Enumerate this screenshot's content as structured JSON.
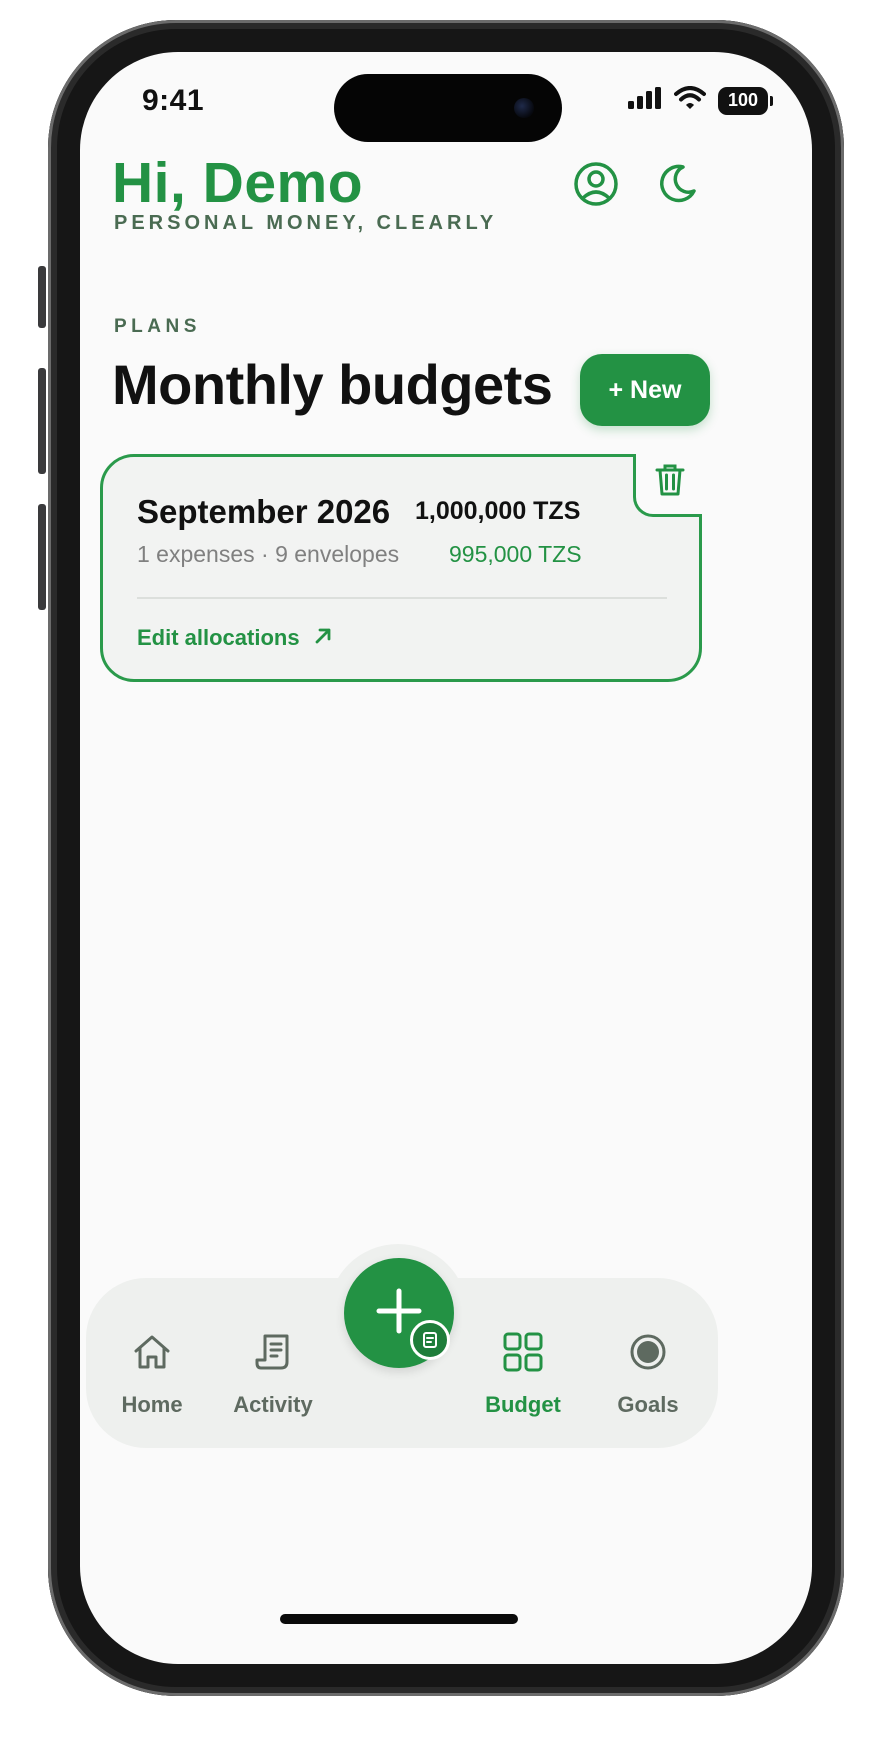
{
  "status_bar": {
    "time": "9:41",
    "battery": "100",
    "icons": [
      "signal-icon",
      "wifi-icon",
      "battery-icon"
    ]
  },
  "header": {
    "greeting": "Hi, Demo",
    "tagline": "PERSONAL MONEY, CLEARLY",
    "profile_icon": "profile-icon",
    "theme_icon": "moon-icon"
  },
  "section": {
    "label": "PLANS",
    "title": "Monthly budgets",
    "new_button": "+ New"
  },
  "budgets": [
    {
      "title": "September 2026",
      "total": "1,000,000 TZS",
      "meta": "1 expenses · 9 envelopes",
      "remaining": "995,000 TZS",
      "link": "Edit allocations",
      "link_icon": "arrow-up-right-icon",
      "delete_icon": "trash-icon"
    }
  ],
  "nav": {
    "items": [
      {
        "label": "Home",
        "icon": "home-icon",
        "active": false
      },
      {
        "label": "Activity",
        "icon": "receipt-icon",
        "active": false
      },
      {
        "label": "Budget",
        "icon": "grid-icon",
        "active": true
      },
      {
        "label": "Goals",
        "icon": "target-icon",
        "active": false
      }
    ],
    "fab_icon": "plus-icon",
    "fab_badge_icon": "receipt-badge-icon"
  },
  "colors": {
    "accent": "#239244",
    "accent_muted": "#4a6b52",
    "text": "#111111",
    "muted_text": "#808080",
    "nav_inactive": "#5e6a60",
    "screen_bg": "#fafafa",
    "nav_bg": "#eef0ee"
  }
}
